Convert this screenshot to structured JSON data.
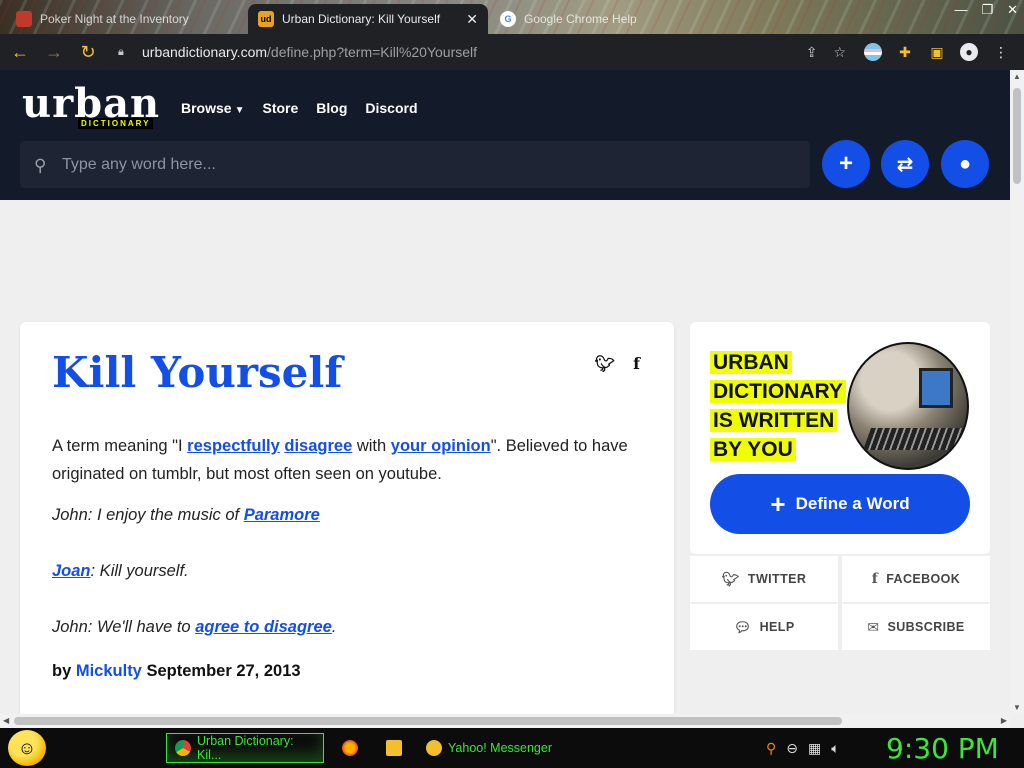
{
  "browser": {
    "tabs": [
      {
        "title": "Poker Night at the Inventory",
        "favicon_color": "#c0392b"
      },
      {
        "title": "Urban Dictionary: Kill Yourself",
        "favicon_text": "ud",
        "favicon_color": "#e8a21b"
      },
      {
        "title": "Google Chrome Help",
        "favicon_text": "G",
        "favicon_color": "#4285f4"
      }
    ],
    "url_domain": "urbandictionary.com",
    "url_path": "/define.php?term=Kill%20Yourself",
    "window_controls": [
      "—",
      "❐",
      "✕"
    ]
  },
  "site": {
    "logo_text": "urban",
    "logo_sub": "DICTIONARY",
    "nav": [
      "Browse",
      "Store",
      "Blog",
      "Discord"
    ],
    "search_placeholder": "Type any word here...",
    "accent": "#134fe6",
    "highlight": "#efff00"
  },
  "definition": {
    "word": "Kill Yourself",
    "meaning_pre": "A term meaning \"I ",
    "link1": "respectfully",
    "link2": "disagree",
    "meaning_mid": " with ",
    "link3": "your opinion",
    "meaning_post": "\". Believed to have originated on tumblr, but most often seen on youtube.",
    "example1_pre": "John: I enjoy the music of ",
    "example1_link": "Paramore",
    "example2_link": "Joan",
    "example2_post": ": Kill yourself.",
    "example3_pre": "John: We'll have to ",
    "example3_link": "agree to disagree",
    "example3_post": ".",
    "by": "by ",
    "author": "Mickulty",
    "date": "September 27, 2013"
  },
  "sidebar": {
    "promo_lines": [
      "URBAN",
      "DICTIONARY",
      "IS WRITTEN",
      "BY YOU"
    ],
    "define_button": "Define a Word",
    "social": [
      {
        "label": "TWITTER",
        "icon": "twitter-icon"
      },
      {
        "label": "FACEBOOK",
        "icon": "facebook-icon"
      },
      {
        "label": "HELP",
        "icon": "chat-icon"
      },
      {
        "label": "SUBSCRIBE",
        "icon": "mail-icon"
      }
    ]
  },
  "taskbar": {
    "tasks": [
      "Urban Dictionary: Kil...",
      "Yahoo! Messenger"
    ],
    "clock": "9:30 PM",
    "accent": "#39e639"
  }
}
